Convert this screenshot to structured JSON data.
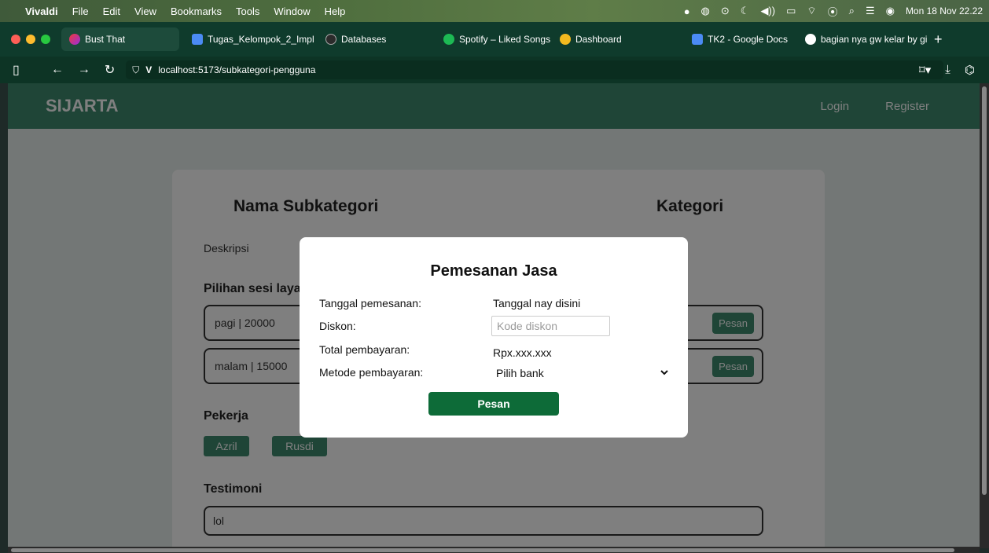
{
  "menubar": {
    "app": "Vivaldi",
    "items": [
      "File",
      "Edit",
      "View",
      "Bookmarks",
      "Tools",
      "Window",
      "Help"
    ],
    "datetime": "Mon 18 Nov 22.22"
  },
  "tabs": [
    {
      "label": "Bust That",
      "icon": "vivaldi-icon"
    },
    {
      "label": "Tugas_Kelompok_2_Impl",
      "icon": "docs-icon"
    },
    {
      "label": "Databases",
      "icon": "database-icon"
    },
    {
      "label": "Spotify – Liked Songs",
      "icon": "spotify-icon"
    },
    {
      "label": "Dashboard",
      "icon": "dashboard-icon"
    },
    {
      "label": "TK2 - Google Docs",
      "icon": "docs-icon"
    },
    {
      "label": "bagian nya gw kelar by gi",
      "icon": "github-icon"
    }
  ],
  "address": {
    "url": "localhost:5173/subkategori-pengguna"
  },
  "site": {
    "brand": "SIJARTA",
    "login": "Login",
    "register": "Register"
  },
  "card": {
    "subkategori_title": "Nama Subkategori",
    "kategori_title": "Kategori",
    "deskripsi": "Deskripsi",
    "sesi_heading": "Pilihan sesi layanan",
    "sesi": [
      {
        "label": "pagi | 20000",
        "button": "Pesan"
      },
      {
        "label": "malam | 15000",
        "button": "Pesan"
      }
    ],
    "pekerja_heading": "Pekerja",
    "pekerja": [
      "Azril",
      "Rusdi"
    ],
    "testimoni_heading": "Testimoni",
    "testimoni": [
      "lol"
    ]
  },
  "modal": {
    "title": "Pemesanan Jasa",
    "tanggal_label": "Tanggal pemesanan:",
    "tanggal_value": "Tanggal nay disini",
    "diskon_label": "Diskon:",
    "diskon_placeholder": "Kode diskon",
    "total_label": "Total pembayaran:",
    "total_value": "Rpx.xxx.xxx",
    "metode_label": "Metode pembayaran:",
    "metode_selected": "Pilih bank",
    "submit_label": "Pesan"
  }
}
